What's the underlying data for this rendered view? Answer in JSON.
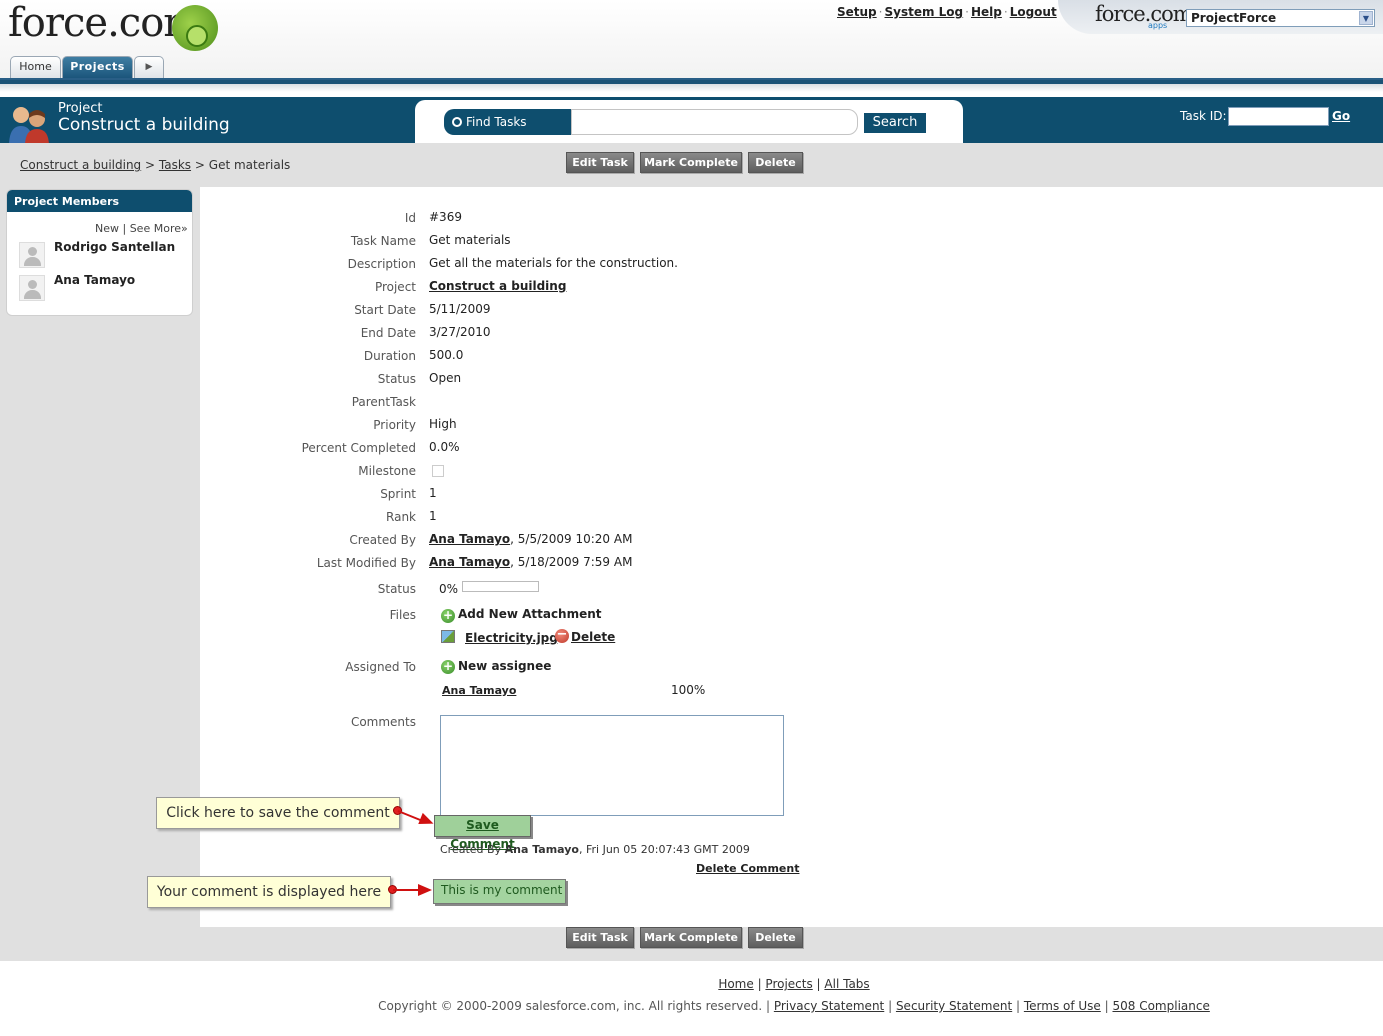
{
  "header": {
    "logo_text": "force.com",
    "top_links": [
      "Setup",
      "System Log",
      "Help",
      "Logout"
    ],
    "apps_logo": "force.com",
    "apps_sub": "apps",
    "app_selector_value": "ProjectForce",
    "tabs": [
      "Home",
      "Projects"
    ]
  },
  "band": {
    "project_label": "Project",
    "project_name": "Construct a building",
    "find_tasks_label": "Find Tasks",
    "search_button": "Search",
    "task_id_label": "Task ID:",
    "go_label": "Go"
  },
  "breadcrumb": {
    "items": [
      "Construct a building",
      "Tasks"
    ],
    "separator": ">",
    "current": "Get materials"
  },
  "actions": {
    "edit": "Edit Task",
    "complete": "Mark Complete",
    "delete": "Delete"
  },
  "sidebar": {
    "title": "Project Members",
    "new_link": "New",
    "see_more_link": "See More»",
    "members": [
      "Rodrigo Santellan",
      "Ana Tamayo"
    ]
  },
  "task": {
    "id": {
      "label": "Id",
      "value": "#369"
    },
    "task_name": {
      "label": "Task Name",
      "value": "Get materials"
    },
    "description": {
      "label": "Description",
      "value": "Get all the materials for the construction."
    },
    "project": {
      "label": "Project",
      "value": "Construct a building"
    },
    "start_date": {
      "label": "Start Date",
      "value": "5/11/2009"
    },
    "end_date": {
      "label": "End Date",
      "value": "3/27/2010"
    },
    "duration": {
      "label": "Duration",
      "value": "500.0"
    },
    "status": {
      "label": "Status",
      "value": "Open"
    },
    "parent_task": {
      "label": "ParentTask",
      "value": ""
    },
    "priority": {
      "label": "Priority",
      "value": "High"
    },
    "percent_completed": {
      "label": "Percent Completed",
      "value": "0.0%"
    },
    "milestone": {
      "label": "Milestone",
      "checked": false
    },
    "sprint": {
      "label": "Sprint",
      "value": "1"
    },
    "rank": {
      "label": "Rank",
      "value": "1"
    },
    "created_by": {
      "label": "Created By",
      "user": "Ana Tamayo",
      "date": ", 5/5/2009 10:20 AM"
    },
    "last_modified_by": {
      "label": "Last Modified By",
      "user": "Ana Tamayo",
      "date": ", 5/18/2009 7:59 AM"
    },
    "progress": {
      "label": "Status",
      "value": "0%",
      "fraction": 0
    },
    "files": {
      "label": "Files",
      "add_attachment": "Add New Attachment",
      "file_name": "Electricity.jpg",
      "delete_label": "Delete"
    },
    "assigned_to": {
      "label": "Assigned To",
      "new_assignee": "New assignee",
      "assignee": "Ana Tamayo",
      "percent": "100%"
    }
  },
  "comments": {
    "label": "Comments",
    "textarea_value": "",
    "save_button": "Save Comment",
    "meta_prefix": "Created By ",
    "meta_user": "Ana Tamayo",
    "meta_date": ", Fri Jun 05 20:07:43 GMT 2009",
    "delete_comment": "Delete Comment",
    "comment_text": "This is my comment"
  },
  "callouts": {
    "save": "Click here to save the comment",
    "display": "Your comment is displayed here"
  },
  "footer": {
    "links": [
      "Home",
      "Projects",
      "All Tabs"
    ],
    "copyright": "Copyright © 2000-2009 salesforce.com, inc. All rights reserved.",
    "legal_links": [
      "Privacy Statement",
      "Security Statement",
      "Terms of Use",
      "508 Compliance"
    ]
  },
  "colors": {
    "brand_blue": "#0e4e6e",
    "button_gray": "#6e6e6e",
    "comment_green": "#a4d4a0",
    "callout_yellow": "#ffffd6"
  }
}
